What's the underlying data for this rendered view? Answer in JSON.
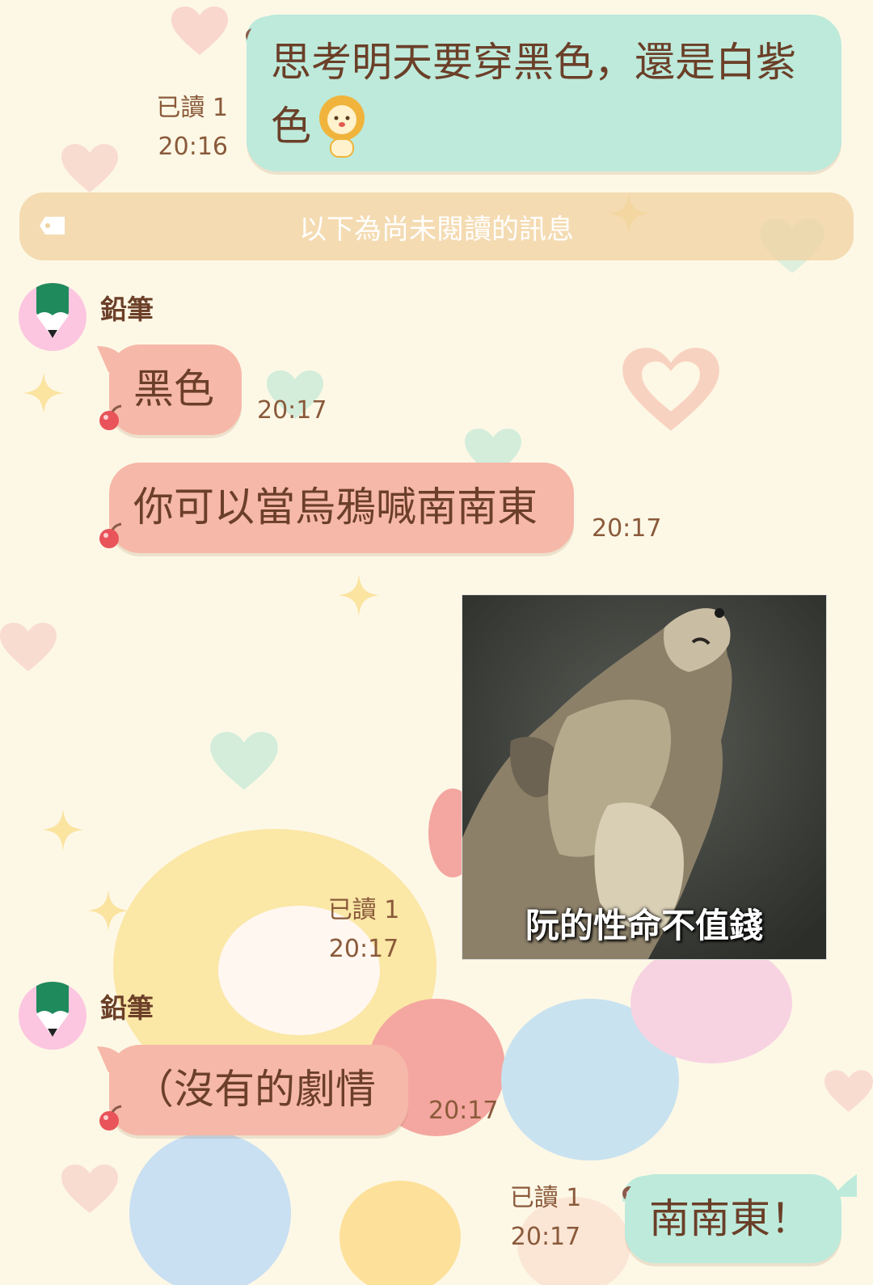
{
  "unread_divider": {
    "text": "以下為尚未閱讀的訊息"
  },
  "messages": [
    {
      "sender": "me",
      "text_line1": "思考明天要穿黑色，還是白紫",
      "text_line2": "色",
      "read": "已讀 1",
      "time": "20:16"
    },
    {
      "sender_name": "鉛筆",
      "text": "黑色",
      "time": "20:17"
    },
    {
      "text": "你可以當烏鴉喊南南東",
      "time": "20:17"
    },
    {
      "sender": "me",
      "image_caption": "阮的性命不值錢",
      "read": "已讀 1",
      "time": "20:17"
    },
    {
      "sender_name": "鉛筆",
      "text": "（沒有的劇情",
      "time": "20:17"
    },
    {
      "sender": "me",
      "text": "南南東！",
      "read": "已讀 1",
      "time": "20:17"
    }
  ],
  "colors": {
    "my_bubble": "#bdeadb",
    "their_bubble": "#f6b8a8",
    "background": "#fdf8e6"
  }
}
